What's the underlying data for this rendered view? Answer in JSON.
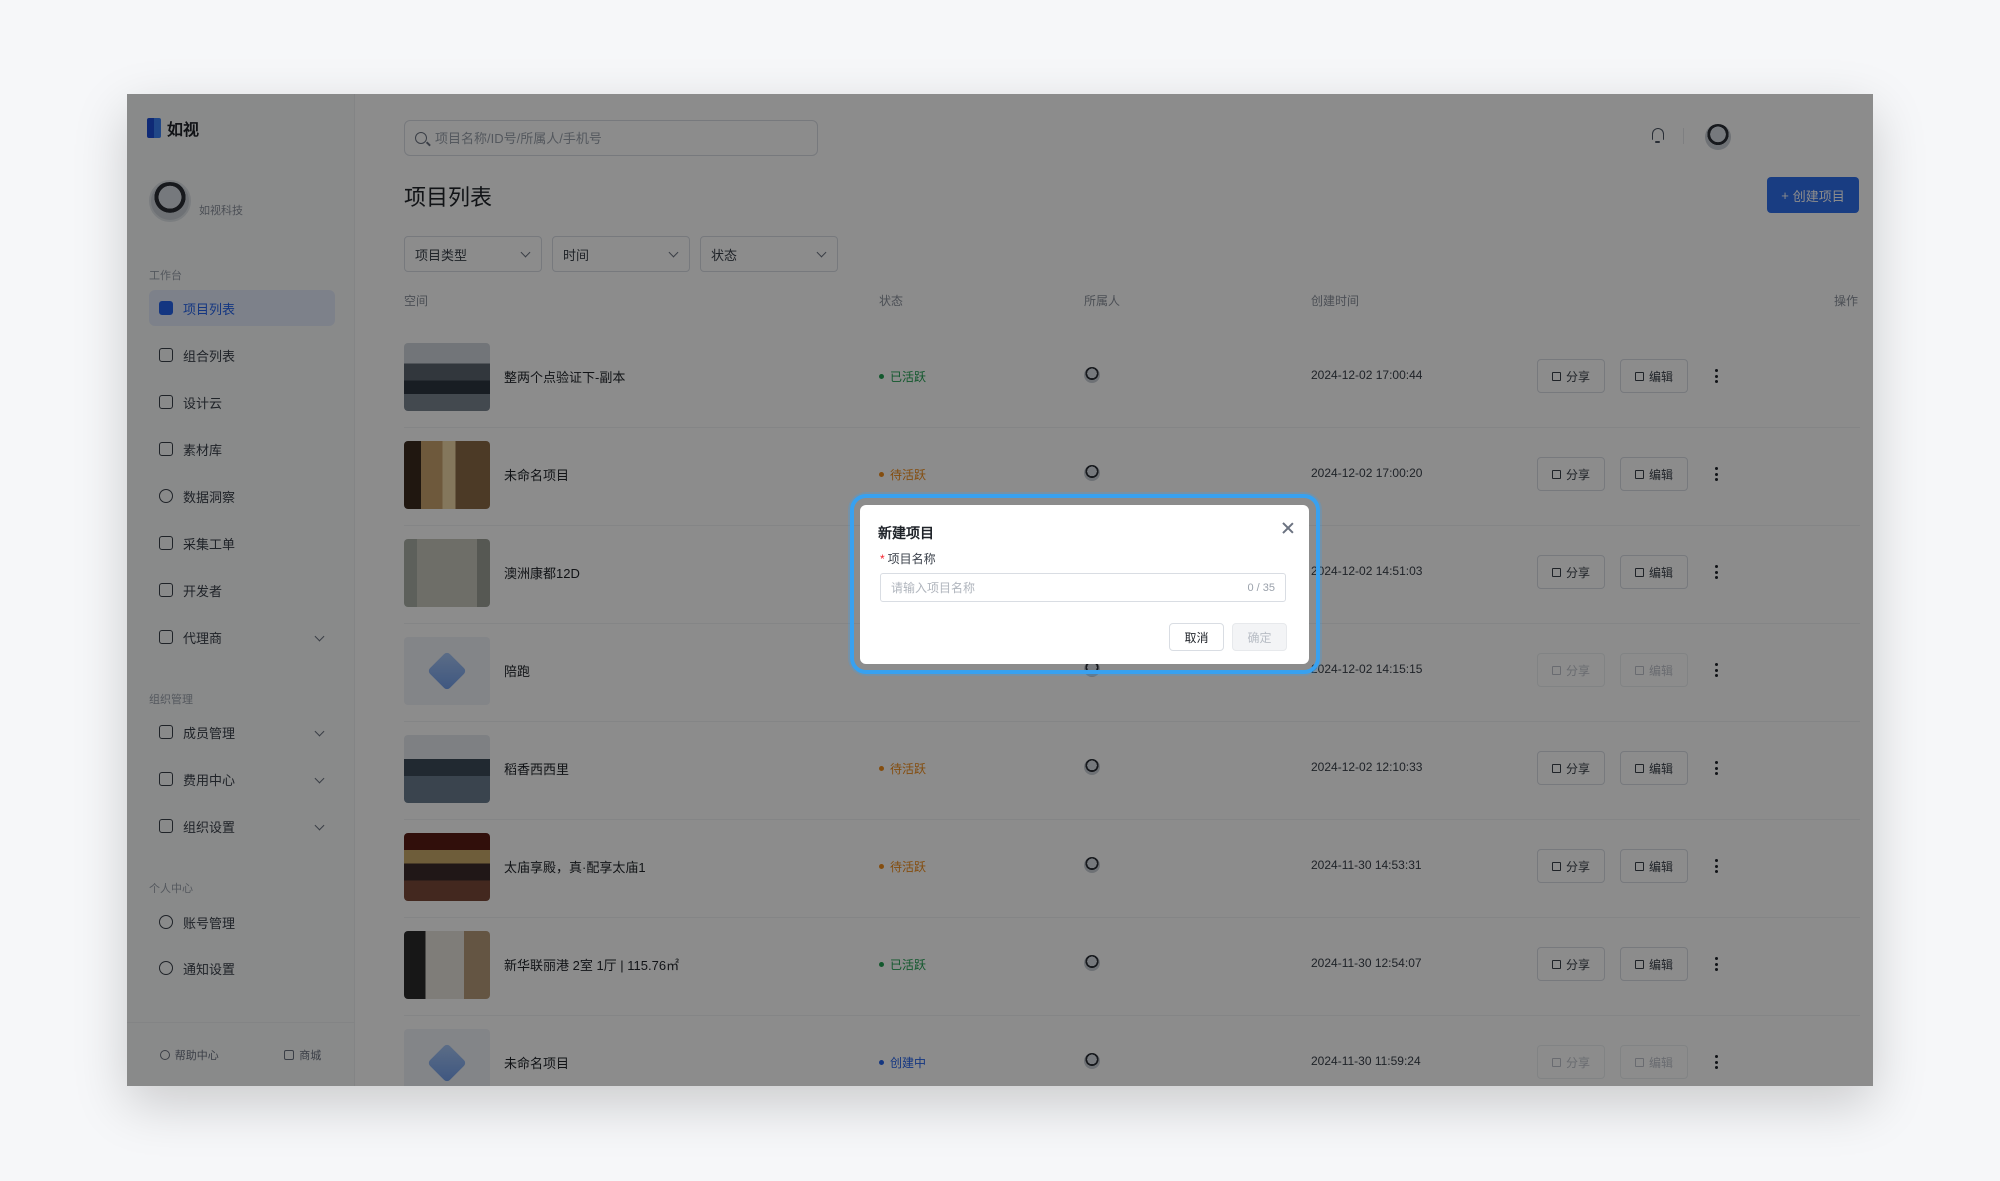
{
  "brand": {
    "name": "如视"
  },
  "profile": {
    "org": "如视科技"
  },
  "sidebar": {
    "sections": [
      {
        "title": "工作台"
      },
      {
        "title": "组织管理"
      },
      {
        "title": "个人中心"
      }
    ],
    "items": [
      {
        "label": "项目列表",
        "icon": "project-list-icon"
      },
      {
        "label": "组合列表",
        "icon": "layers-icon"
      },
      {
        "label": "设计云",
        "icon": "design-cloud-icon"
      },
      {
        "label": "素材库",
        "icon": "folder-icon"
      },
      {
        "label": "数据洞察",
        "icon": "pie-chart-icon"
      },
      {
        "label": "采集工单",
        "icon": "document-icon"
      },
      {
        "label": "开发者",
        "icon": "code-icon"
      },
      {
        "label": "代理商",
        "icon": "briefcase-icon"
      },
      {
        "label": "成员管理",
        "icon": "users-icon"
      },
      {
        "label": "费用中心",
        "icon": "wallet-icon"
      },
      {
        "label": "组织设置",
        "icon": "shield-icon"
      },
      {
        "label": "账号管理",
        "icon": "user-icon"
      },
      {
        "label": "通知设置",
        "icon": "bell-settings-icon"
      }
    ],
    "footer": {
      "help": "帮助中心",
      "mall": "商城"
    }
  },
  "header": {
    "search_placeholder": "项目名称/ID号/所属人/手机号",
    "page_title": "项目列表",
    "create_button": "创建项目",
    "accent": "#2f6fed"
  },
  "filters": [
    "项目类型",
    "时间",
    "状态"
  ],
  "table": {
    "columns": [
      "空间",
      "状态",
      "所属人",
      "创建时间",
      "操作"
    ],
    "share_label": "分享",
    "edit_label": "编辑",
    "rows": [
      {
        "name": "整两个点验证下-副本",
        "status": "已活跃",
        "status_color": "#22a052",
        "time": "2024-12-02 17:00:44",
        "thumb": "office",
        "disabled": false
      },
      {
        "name": "未命名项目",
        "status": "待活跃",
        "status_color": "#f08c1b",
        "time": "2024-12-02 17:00:20",
        "thumb": "hall",
        "disabled": false
      },
      {
        "name": "澳洲康都12D",
        "status": "",
        "status_color": "#f08c1b",
        "time": "2024-12-02 14:51:03",
        "thumb": "room",
        "disabled": false
      },
      {
        "name": "陪跑",
        "status": "",
        "status_color": "#f08c1b",
        "time": "2024-12-02 14:15:15",
        "thumb": "placeholder",
        "disabled": true
      },
      {
        "name": "稻香西西里",
        "status": "待活跃",
        "status_color": "#f08c1b",
        "time": "2024-12-02 12:10:33",
        "thumb": "workshop",
        "disabled": false
      },
      {
        "name": "太庙享殿，真·配享太庙1",
        "status": "待活跃",
        "status_color": "#f08c1b",
        "time": "2024-11-30 14:53:31",
        "thumb": "temple",
        "disabled": false
      },
      {
        "name": "新华联丽港 2室 1厅 | 115.76㎡",
        "status": "已活跃",
        "status_color": "#22a052",
        "time": "2024-11-30 12:54:07",
        "thumb": "living",
        "disabled": false
      },
      {
        "name": "未命名项目",
        "status": "创建中",
        "status_color": "#2563eb",
        "time": "2024-11-30 11:59:24",
        "thumb": "placeholder",
        "disabled": true
      }
    ]
  },
  "modal": {
    "title": "新建项目",
    "field_label": "项目名称",
    "required_mark": "*",
    "placeholder": "请输入项目名称",
    "counter": "0 / 35",
    "cancel": "取消",
    "ok": "确定"
  }
}
